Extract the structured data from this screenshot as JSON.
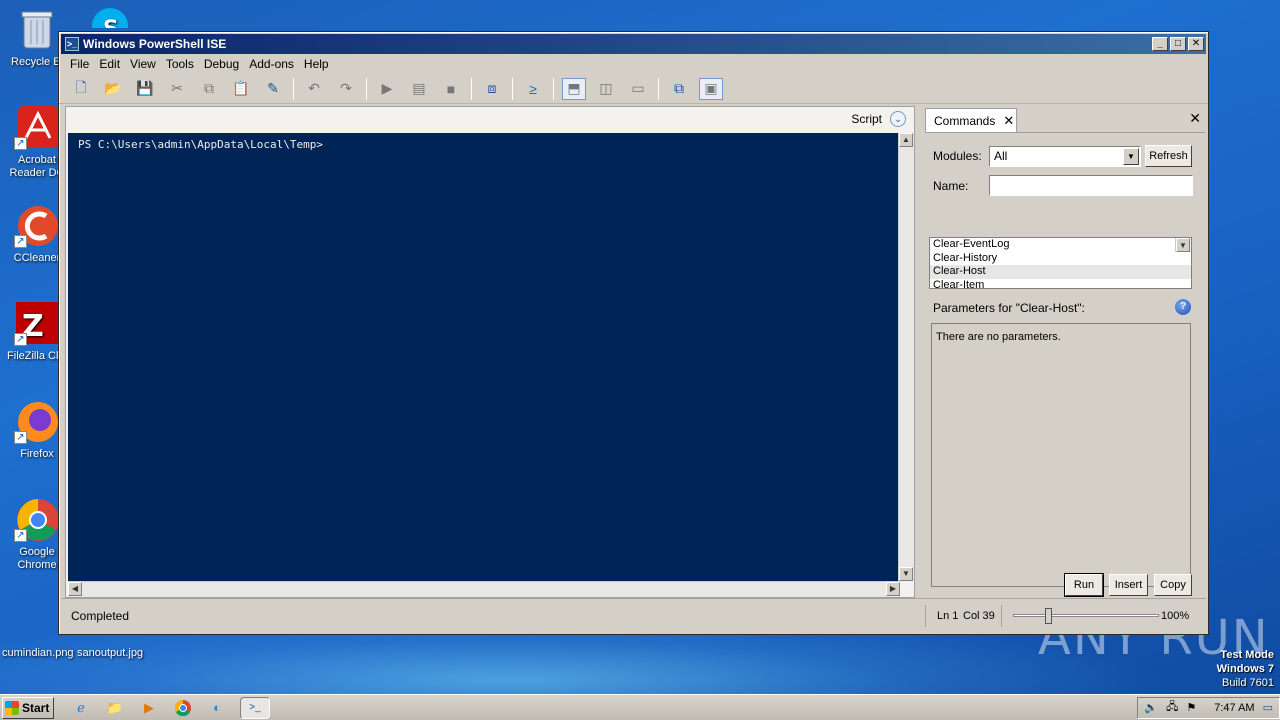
{
  "desktop": {
    "icons": [
      {
        "label": "Recycle Bin",
        "short": "Recycle Bi"
      },
      {
        "label": "Acrobat Reader DC",
        "short": "Acrobat\nReader DC"
      },
      {
        "label": "CCleaner",
        "short": "CCleaner"
      },
      {
        "label": "FileZilla Client",
        "short": "FileZilla Clie"
      },
      {
        "label": "Firefox",
        "short": "Firefox"
      },
      {
        "label": "Google Chrome",
        "short": "Google\nChrome"
      }
    ],
    "files": [
      "cumindian.png",
      "sanoutput.jpg"
    ],
    "watermark": "ANY RUN",
    "test_mode": {
      "line1": "Test Mode",
      "line2": "Windows 7",
      "line3": "Build 7601"
    }
  },
  "window": {
    "title": "Windows PowerShell ISE",
    "menu": [
      "File",
      "Edit",
      "View",
      "Tools",
      "Debug",
      "Add-ons",
      "Help"
    ],
    "toolbar_icons": [
      "new-icon",
      "open-icon",
      "save-icon",
      "cut-icon",
      "copy-icon",
      "paste-icon",
      "clear-console-icon",
      "undo-icon",
      "redo-icon",
      "run-icon",
      "run-selection-icon",
      "stop-icon",
      "new-remote-tab-icon",
      "start-powershell-icon",
      "layout-top-icon",
      "layout-right-icon",
      "layout-max-icon",
      "show-script-pane-icon",
      "show-commands-icon"
    ]
  },
  "editor": {
    "script_label": "Script",
    "prompt": "PS C:\\Users\\admin\\AppData\\Local\\Temp>"
  },
  "commands": {
    "tab_label": "Commands",
    "modules_label": "Modules:",
    "modules_value": "All",
    "refresh_label": "Refresh",
    "name_label": "Name:",
    "name_value": "",
    "list": [
      "Clear-EventLog",
      "Clear-History",
      "Clear-Host",
      "Clear-Item"
    ],
    "selected": "Clear-Host",
    "params_title": "Parameters for \"Clear-Host\":",
    "params_text": "There are no parameters.",
    "run_label": "Run",
    "insert_label": "Insert",
    "copy_label": "Copy"
  },
  "status": {
    "text": "Completed",
    "ln": "Ln 1",
    "col": "Col 39",
    "zoom": "100%",
    "zoom_fraction": 0.23
  },
  "taskbar": {
    "start_label": "Start",
    "apps": [
      "ie-icon",
      "explorer-icon",
      "media-player-icon",
      "chrome-icon",
      "edge-icon",
      "powershell-ise-icon"
    ],
    "clock": "7:47 AM"
  },
  "colors": {
    "console_bg": "#012456",
    "title_start": "#0a246a",
    "title_end": "#3a6ea5"
  }
}
